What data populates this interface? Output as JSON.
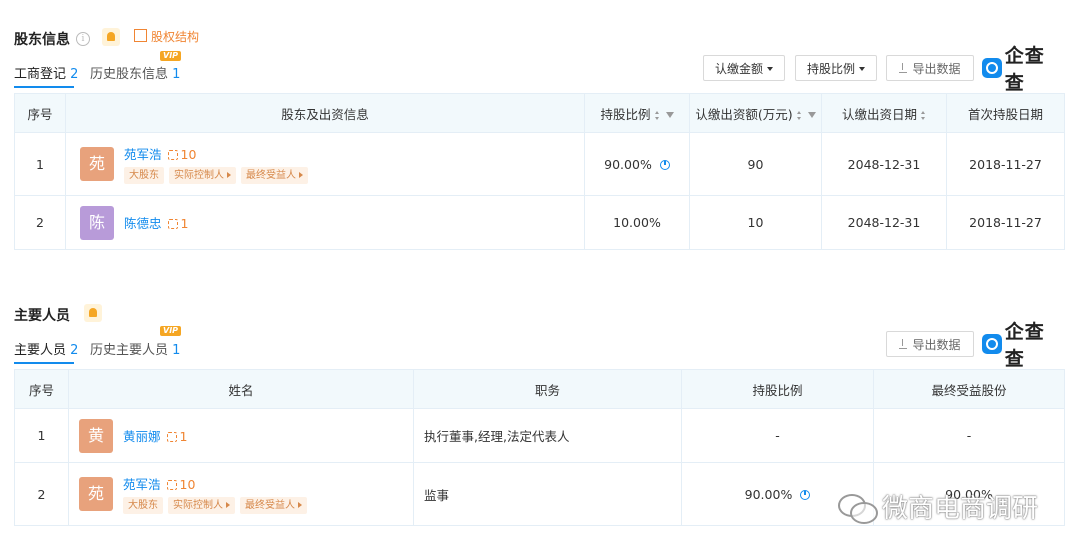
{
  "shareholders": {
    "title": "股东信息",
    "equity_link": "股权结构",
    "tabs": [
      {
        "label": "工商登记",
        "count": "2"
      },
      {
        "label": "历史股东信息",
        "count": "1"
      }
    ],
    "vip_badge": "VIP",
    "filters": {
      "amount": "认缴金额",
      "ratio": "持股比例"
    },
    "export_label": "导出数据",
    "logo_text": "企查查",
    "columns": [
      "序号",
      "股东及出资信息",
      "持股比例",
      "认缴出资额(万元)",
      "认缴出资日期",
      "首次持股日期"
    ],
    "rows": [
      {
        "index": "1",
        "avatar": "苑",
        "avatar_color": "#e8a27c",
        "name": "苑军浩",
        "related": "10",
        "tags": [
          "大股东",
          "实际控制人",
          "最终受益人"
        ],
        "ratio": "90.00%",
        "amount": "90",
        "sub_date": "2048-12-31",
        "first_date": "2018-11-27"
      },
      {
        "index": "2",
        "avatar": "陈",
        "avatar_color": "#b89bd9",
        "name": "陈德忠",
        "related": "1",
        "tags": [],
        "ratio": "10.00%",
        "amount": "10",
        "sub_date": "2048-12-31",
        "first_date": "2018-11-27"
      }
    ]
  },
  "personnel": {
    "title": "主要人员",
    "tabs": [
      {
        "label": "主要人员",
        "count": "2"
      },
      {
        "label": "历史主要人员",
        "count": "1"
      }
    ],
    "vip_badge": "VIP",
    "export_label": "导出数据",
    "logo_text": "企查查",
    "columns": [
      "序号",
      "姓名",
      "职务",
      "持股比例",
      "最终受益股份"
    ],
    "rows": [
      {
        "index": "1",
        "avatar": "黄",
        "avatar_color": "#e8a27c",
        "name": "黄丽娜",
        "related": "1",
        "tags": [],
        "position": "执行董事,经理,法定代表人",
        "ratio": "-",
        "benefit": "-"
      },
      {
        "index": "2",
        "avatar": "苑",
        "avatar_color": "#e8a27c",
        "name": "苑军浩",
        "related": "10",
        "tags": [
          "大股东",
          "实际控制人",
          "最终受益人"
        ],
        "position": "监事",
        "ratio": "90.00%",
        "benefit": "90.00%"
      }
    ]
  },
  "watermark": "微商电商调研"
}
